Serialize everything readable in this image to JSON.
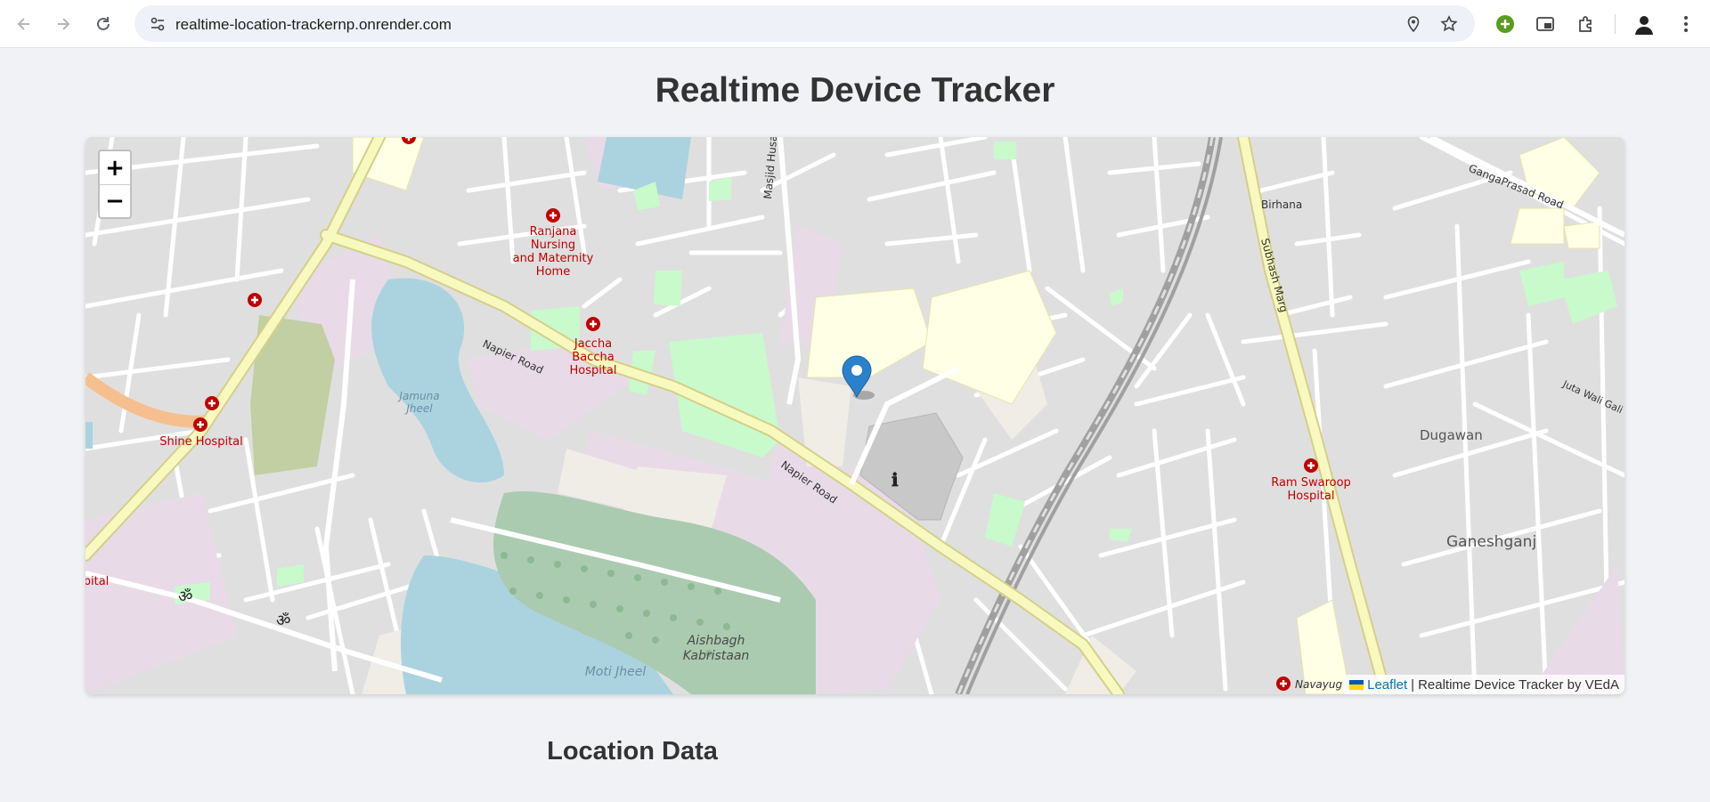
{
  "browser": {
    "url": "realtime-location-trackernp.onrender.com"
  },
  "page": {
    "title": "Realtime Device Tracker",
    "section_title": "Location Data"
  },
  "map": {
    "zoom_in_label": "+",
    "zoom_out_label": "−",
    "attribution_link": "Leaflet",
    "attribution_sep": "|",
    "attribution_text": "Realtime Device Tracker by VEdA",
    "labels": {
      "ranjana_l1": "Ranjana",
      "ranjana_l2": "Nursing",
      "ranjana_l3": "and Maternity",
      "ranjana_l4": "Home",
      "jaccha_l1": "Jaccha",
      "jaccha_l2": "Baccha",
      "jaccha_l3": "Hospital",
      "shine": "Shine Hospital",
      "jamuna_l1": "Jamuna",
      "jamuna_l2": "Jheel",
      "napier_1": "Napier Road",
      "napier_2": "Napier Road",
      "masjid": "Masjid Husai",
      "birhana": "Birhana",
      "subhash": "Subhash Marg",
      "gangaprasad": "GangaPrasad Road",
      "juta": "Juta Wali Gali",
      "dugawan": "Dugawan",
      "ram_l1": "Ram Swaroop",
      "ram_l2": "Hospital",
      "ganesh": "Ganeshganj",
      "aishbagh_l1": "Aishbagh",
      "aishbagh_l2": "Kabristaan",
      "moti": "Moti Jheel",
      "navayug": "Navayug",
      "hospital_edge": "pital"
    },
    "colors": {
      "marker": "#2a81cb",
      "hospital": "#c00000",
      "main_road": "#f7f9be",
      "water": "#aad3df",
      "park": "#c8facc",
      "cemetery": "#aacbaf",
      "school": "#ffffe5"
    }
  }
}
